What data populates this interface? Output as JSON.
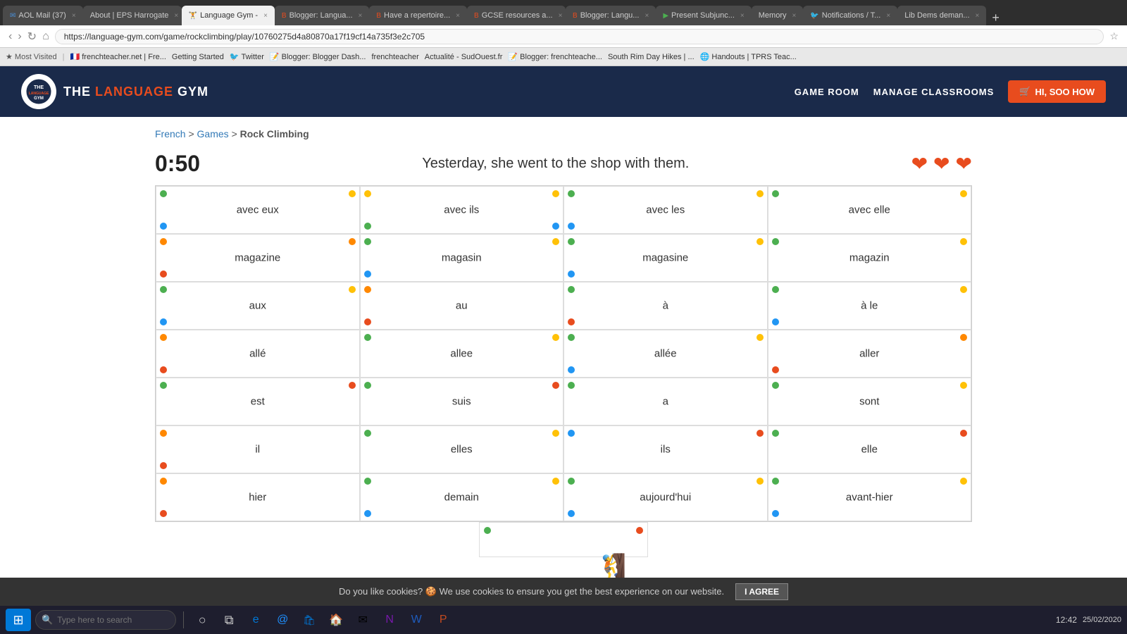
{
  "browser": {
    "tabs": [
      {
        "label": "AOL Mail (37)",
        "active": false,
        "color": "#4a90d9"
      },
      {
        "label": "About | EPS Harrogate",
        "active": false,
        "color": "#888"
      },
      {
        "label": "Language Gym -",
        "active": true,
        "color": "#4a90d9"
      },
      {
        "label": "Blogger: Langua...",
        "active": false,
        "color": "#e84c1e"
      },
      {
        "label": "Have a repertoire...",
        "active": false,
        "color": "#e84c1e"
      },
      {
        "label": "GCSE resources a...",
        "active": false,
        "color": "#e84c1e"
      },
      {
        "label": "Blogger: Langu...",
        "active": false,
        "color": "#e84c1e"
      },
      {
        "label": "Present Subjunc...",
        "active": false,
        "color": "#4caf50"
      },
      {
        "label": "Memory",
        "active": false,
        "color": "#4a4a4a"
      },
      {
        "label": "Notifications / T...",
        "active": false,
        "color": "#1da1f2"
      },
      {
        "label": "Lib Dems deman...",
        "active": false,
        "color": "#888"
      }
    ],
    "address": "https://language-gym.com/game/rockclimbing/play/10760275d4a80870a17f19cf14a735f3e2c705",
    "bookmarks": [
      "Most Visited",
      "frenchteacher.net | Fre...",
      "Getting Started",
      "Twitter",
      "Blogger: Blogger Dash...",
      "frenchteacher",
      "Actualité - SudOuest.fr",
      "Blogger: frenchteache...",
      "South Rim Day Hikes | ...",
      "Handouts | TPRS Teac..."
    ]
  },
  "header": {
    "logo_text_main": "THE ",
    "logo_text_brand": "LANGUAGE",
    "logo_text_end": " GYM",
    "nav_game_room": "GAME ROOM",
    "nav_manage": "MANAGE CLASSROOMS",
    "user_btn": "HI, SOO HOW"
  },
  "breadcrumb": {
    "french": "French",
    "games": "Games",
    "rock_climbing": "Rock Climbing",
    "sep1": ">",
    "sep2": ">"
  },
  "game": {
    "timer": "0:50",
    "sentence": "Yesterday, she went to the shop with them.",
    "lives": 3,
    "grid": [
      [
        {
          "text": "avec eux",
          "dots": [
            {
              "pos": "tl",
              "color": "green"
            },
            {
              "pos": "tr",
              "color": "yellow"
            },
            {
              "pos": "bl",
              "color": "blue"
            }
          ]
        },
        {
          "text": "avec ils",
          "dots": [
            {
              "pos": "tl",
              "color": "yellow"
            },
            {
              "pos": "tr",
              "color": "yellow"
            },
            {
              "pos": "bl",
              "color": "green"
            },
            {
              "pos": "br",
              "color": "blue"
            }
          ]
        },
        {
          "text": "avec les",
          "dots": [
            {
              "pos": "tl",
              "color": "green"
            },
            {
              "pos": "tr",
              "color": "yellow"
            },
            {
              "pos": "bl",
              "color": "blue"
            }
          ]
        },
        {
          "text": "avec elle",
          "dots": [
            {
              "pos": "tl",
              "color": "green"
            },
            {
              "pos": "tr",
              "color": "yellow"
            }
          ]
        }
      ],
      [
        {
          "text": "magazine",
          "dots": [
            {
              "pos": "tl",
              "color": "orange"
            },
            {
              "pos": "tr",
              "color": "orange"
            },
            {
              "pos": "bl",
              "color": "red"
            }
          ]
        },
        {
          "text": "magasin",
          "dots": [
            {
              "pos": "tl",
              "color": "green"
            },
            {
              "pos": "tr",
              "color": "yellow"
            },
            {
              "pos": "bl",
              "color": "blue"
            }
          ]
        },
        {
          "text": "magasine",
          "dots": [
            {
              "pos": "tl",
              "color": "green"
            },
            {
              "pos": "tr",
              "color": "yellow"
            },
            {
              "pos": "bl",
              "color": "blue"
            }
          ]
        },
        {
          "text": "magazin",
          "dots": [
            {
              "pos": "tl",
              "color": "green"
            },
            {
              "pos": "tr",
              "color": "yellow"
            }
          ]
        }
      ],
      [
        {
          "text": "aux",
          "dots": [
            {
              "pos": "tl",
              "color": "green"
            },
            {
              "pos": "tr",
              "color": "yellow"
            },
            {
              "pos": "bl",
              "color": "blue"
            }
          ]
        },
        {
          "text": "au",
          "dots": [
            {
              "pos": "tl",
              "color": "orange"
            },
            {
              "pos": "bl",
              "color": "red"
            }
          ]
        },
        {
          "text": "à",
          "dots": [
            {
              "pos": "tl",
              "color": "green"
            },
            {
              "pos": "bl",
              "color": "red"
            }
          ]
        },
        {
          "text": "à le",
          "dots": [
            {
              "pos": "tl",
              "color": "green"
            },
            {
              "pos": "tr",
              "color": "yellow"
            },
            {
              "pos": "bl",
              "color": "blue"
            }
          ]
        }
      ],
      [
        {
          "text": "allé",
          "dots": [
            {
              "pos": "tl",
              "color": "orange"
            },
            {
              "pos": "bl",
              "color": "red"
            }
          ]
        },
        {
          "text": "allee",
          "dots": [
            {
              "pos": "tr",
              "color": "yellow"
            },
            {
              "pos": "tl",
              "color": "green"
            }
          ]
        },
        {
          "text": "allée",
          "dots": [
            {
              "pos": "tl",
              "color": "green"
            },
            {
              "pos": "tr",
              "color": "yellow"
            },
            {
              "pos": "bl",
              "color": "blue"
            }
          ]
        },
        {
          "text": "aller",
          "dots": [
            {
              "pos": "tr",
              "color": "orange"
            },
            {
              "pos": "bl",
              "color": "red"
            }
          ]
        }
      ],
      [
        {
          "text": "est",
          "dots": [
            {
              "pos": "tl",
              "color": "green"
            },
            {
              "pos": "tr",
              "color": "red"
            }
          ]
        },
        {
          "text": "suis",
          "dots": [
            {
              "pos": "tl",
              "color": "green"
            },
            {
              "pos": "tr",
              "color": "red"
            }
          ]
        },
        {
          "text": "a",
          "dots": [
            {
              "pos": "tl",
              "color": "green"
            }
          ]
        },
        {
          "text": "sont",
          "dots": [
            {
              "pos": "tl",
              "color": "green"
            },
            {
              "pos": "tr",
              "color": "yellow"
            }
          ]
        }
      ],
      [
        {
          "text": "il",
          "dots": [
            {
              "pos": "tl",
              "color": "orange"
            },
            {
              "pos": "bl",
              "color": "red"
            }
          ]
        },
        {
          "text": "elles",
          "dots": [
            {
              "pos": "tl",
              "color": "green"
            },
            {
              "pos": "tr",
              "color": "yellow"
            }
          ]
        },
        {
          "text": "ils",
          "dots": [
            {
              "pos": "tl",
              "color": "blue"
            },
            {
              "pos": "tr",
              "color": "red"
            }
          ]
        },
        {
          "text": "elle",
          "dots": [
            {
              "pos": "tl",
              "color": "green"
            },
            {
              "pos": "tr",
              "color": "red"
            }
          ]
        }
      ],
      [
        {
          "text": "hier",
          "dots": [
            {
              "pos": "tl",
              "color": "orange"
            },
            {
              "pos": "bl",
              "color": "red"
            }
          ]
        },
        {
          "text": "demain",
          "dots": [
            {
              "pos": "tl",
              "color": "green"
            },
            {
              "pos": "tr",
              "color": "yellow"
            },
            {
              "pos": "bl",
              "color": "blue"
            }
          ]
        },
        {
          "text": "aujourd'hui",
          "dots": [
            {
              "pos": "tl",
              "color": "green"
            },
            {
              "pos": "tr",
              "color": "yellow"
            },
            {
              "pos": "bl",
              "color": "blue"
            }
          ]
        },
        {
          "text": "avant-hier",
          "dots": [
            {
              "pos": "tl",
              "color": "green"
            },
            {
              "pos": "tr",
              "color": "yellow"
            },
            {
              "pos": "bl",
              "color": "blue"
            }
          ]
        }
      ]
    ]
  },
  "cookie": {
    "message": "Do you like cookies? 🍪 We use cookies to ensure you get the best experience on our website.",
    "btn_label": "I AGREE"
  },
  "taskbar": {
    "time": "12:42",
    "date": "25/02/2020",
    "search_placeholder": "Type here to search"
  }
}
